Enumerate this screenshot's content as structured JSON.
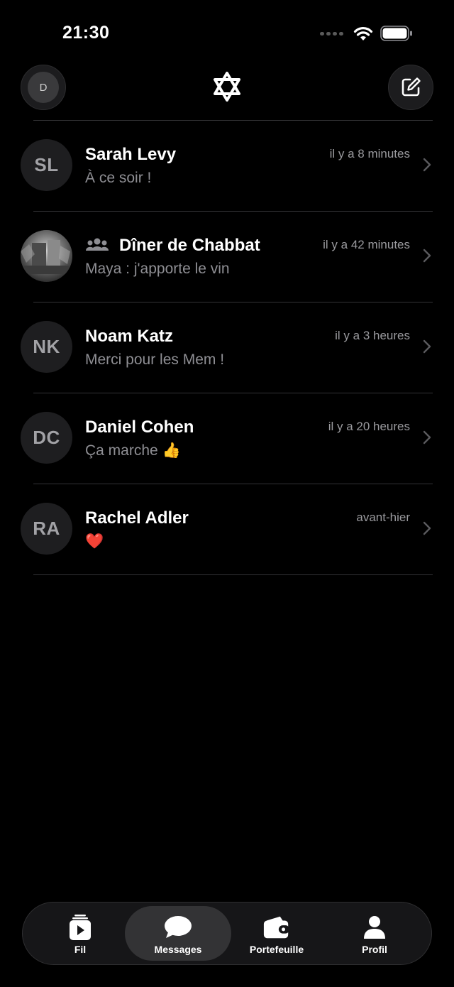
{
  "status_bar": {
    "time": "21:30"
  },
  "header": {
    "avatar_initial": "D"
  },
  "conversations": [
    {
      "initials": "SL",
      "name": "Sarah Levy",
      "time": "il y a 8 minutes",
      "preview": "À ce soir !",
      "is_group": false
    },
    {
      "initials": "",
      "name": "Dîner de Chabbat",
      "time": "il y a 42 minutes",
      "preview": "Maya : j'apporte le vin",
      "is_group": true
    },
    {
      "initials": "NK",
      "name": "Noam Katz",
      "time": "il y a 3 heures",
      "preview": "Merci pour les Mem !",
      "is_group": false
    },
    {
      "initials": "DC",
      "name": "Daniel Cohen",
      "time": "il y a 20 heures",
      "preview": "Ça marche 👍",
      "is_group": false
    },
    {
      "initials": "RA",
      "name": "Rachel Adler",
      "time": "avant-hier",
      "preview": "❤️",
      "is_group": false
    }
  ],
  "tabs": [
    {
      "label": "Fil",
      "icon": "play-feed-icon",
      "active": false
    },
    {
      "label": "Messages",
      "icon": "chat-bubble-icon",
      "active": true
    },
    {
      "label": "Portefeuille",
      "icon": "wallet-icon",
      "active": false
    },
    {
      "label": "Profil",
      "icon": "person-icon",
      "active": false
    }
  ],
  "colors": {
    "background": "#000000",
    "secondary_text": "#8e8e93",
    "avatar_bg": "#1e1e20",
    "active_tab": "#333335"
  }
}
